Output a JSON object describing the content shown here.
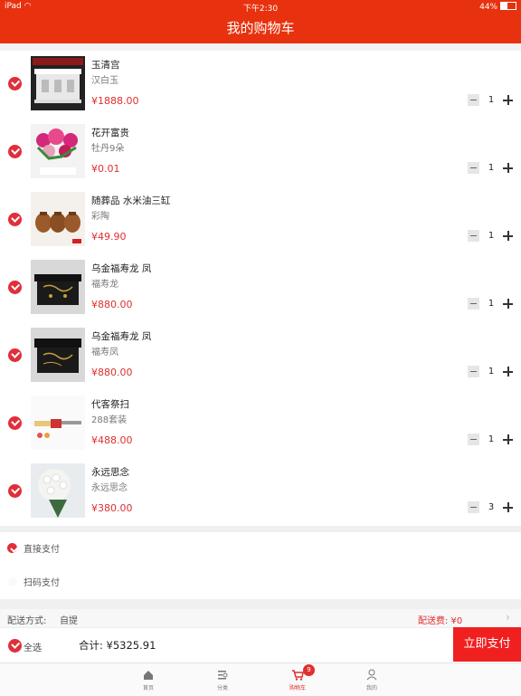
{
  "status_bar": {
    "device": "iPad",
    "time": "下午2:30",
    "battery": "44%"
  },
  "nav": {
    "title": "我的购物车"
  },
  "items": [
    {
      "name": "玉清宫",
      "sub": "汉白玉",
      "price": "¥1888.00",
      "qty": "1",
      "image": "white-jade-pavilion"
    },
    {
      "name": "花开富贵",
      "sub": "牡丹9朵",
      "price": "¥0.01",
      "qty": "1",
      "image": "peony-bouquet"
    },
    {
      "name": "随葬品 水米油三缸",
      "sub": "彩陶",
      "price": "¥49.90",
      "qty": "1",
      "image": "three-pottery-jars"
    },
    {
      "name": "乌金福寿龙  凤",
      "sub": "福寿龙",
      "price": "¥880.00",
      "qty": "1",
      "image": "black-lacquer-box"
    },
    {
      "name": "乌金福寿龙  凤",
      "sub": "福寿凤",
      "price": "¥880.00",
      "qty": "1",
      "image": "black-lacquer-box"
    },
    {
      "name": "代客祭扫",
      "sub": "288套装",
      "price": "¥488.00",
      "qty": "1",
      "image": "offering-set"
    },
    {
      "name": "永远思念",
      "sub": "永远思念",
      "price": "¥380.00",
      "qty": "3",
      "image": "chrysanthemum-bouquet"
    }
  ],
  "payment": {
    "direct": "直接支付",
    "scan": "扫码支付"
  },
  "shipping": {
    "method_label": "配送方式:",
    "method_value": "自提",
    "fee": "配送费: ¥0"
  },
  "bottom_bar": {
    "select_all": "全选",
    "total": "合计: ¥5325.91",
    "pay_button": "立即支付"
  },
  "tabbar": {
    "items": [
      {
        "label": "首页",
        "icon": "home-icon"
      },
      {
        "label": "分类",
        "icon": "category-icon"
      },
      {
        "label": "购物车",
        "icon": "cart-icon",
        "badge": "9"
      },
      {
        "label": "我的",
        "icon": "user-icon"
      }
    ]
  },
  "colors": {
    "brand": "#e8320f",
    "price": "#e02f2f",
    "check": "#e02f3a",
    "pay_button": "#f02020"
  }
}
